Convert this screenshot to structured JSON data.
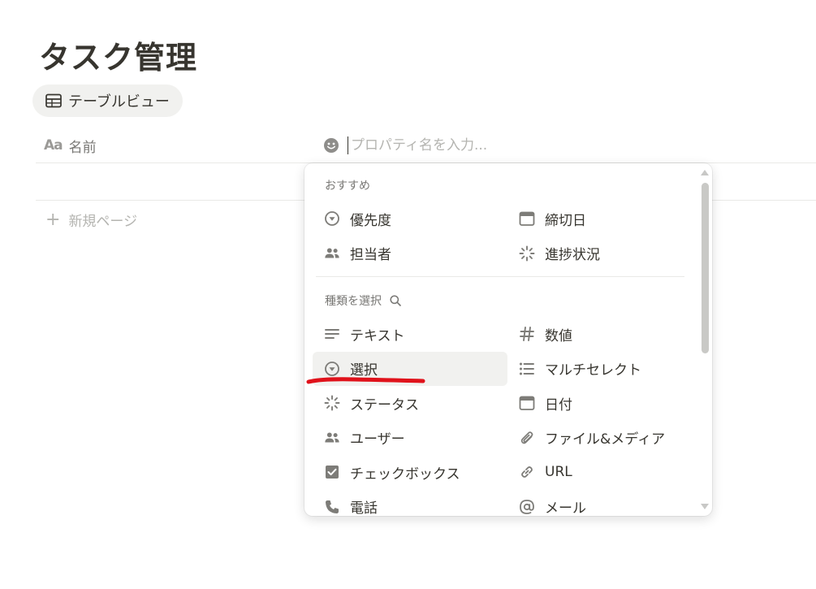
{
  "page": {
    "title": "タスク管理"
  },
  "view_tab": {
    "label": "テーブルビュー"
  },
  "table": {
    "name_column": "名前",
    "name_column_icon": "Aa",
    "property_input_placeholder": "プロパティ名を入力...",
    "new_page_label": "新規ページ"
  },
  "dropdown": {
    "recommended_label": "おすすめ",
    "recommended": [
      {
        "label": "優先度",
        "icon": "select-icon"
      },
      {
        "label": "締切日",
        "icon": "calendar-icon"
      },
      {
        "label": "担当者",
        "icon": "people-icon"
      },
      {
        "label": "進捗状況",
        "icon": "status-icon"
      }
    ],
    "types_label": "種類を選択",
    "types": [
      {
        "label": "テキスト",
        "icon": "text-icon"
      },
      {
        "label": "数値",
        "icon": "hash-icon"
      },
      {
        "label": "選択",
        "icon": "select-icon"
      },
      {
        "label": "マルチセレクト",
        "icon": "list-icon"
      },
      {
        "label": "ステータス",
        "icon": "status-icon"
      },
      {
        "label": "日付",
        "icon": "calendar-icon"
      },
      {
        "label": "ユーザー",
        "icon": "people-icon"
      },
      {
        "label": "ファイル&メディア",
        "icon": "paperclip-icon"
      },
      {
        "label": "チェックボックス",
        "icon": "checkbox-icon"
      },
      {
        "label": "URL",
        "icon": "link-icon"
      },
      {
        "label": "電話",
        "icon": "phone-icon"
      },
      {
        "label": "メール",
        "icon": "at-icon"
      }
    ],
    "selected_type": "選択"
  },
  "colors": {
    "text": "#37352f",
    "muted": "#787774",
    "hover": "#f1f1ef",
    "annotation": "#e0121b"
  }
}
